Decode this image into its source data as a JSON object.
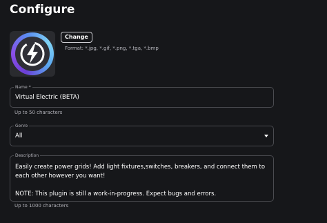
{
  "page": {
    "title": "Configure"
  },
  "image": {
    "icon": "lightning-bolt-icon",
    "change_label": "Change",
    "format_text": "Format: *.jpg, *.gif, *.png, *.tga, *.bmp"
  },
  "name_field": {
    "label": "Name *",
    "value": "Virtual Electric (BETA)",
    "helper": "Up to 50 characters"
  },
  "genre_field": {
    "label": "Genre",
    "value": "All",
    "icon": "dropdown-caret-icon"
  },
  "description_field": {
    "label": "Description",
    "value": "Easily create power grids! Add light fixtures,switches, breakers, and connect them to each other however you want!\n\nNOTE: This plugin is still a work-in-progress. Expect bugs and errors.",
    "helper": "Up to 1000 characters"
  },
  "colors": {
    "background": "#16171a",
    "border": "#4a4b50",
    "ring_start": "#6b3fd6",
    "ring_end": "#7fd3f4"
  }
}
